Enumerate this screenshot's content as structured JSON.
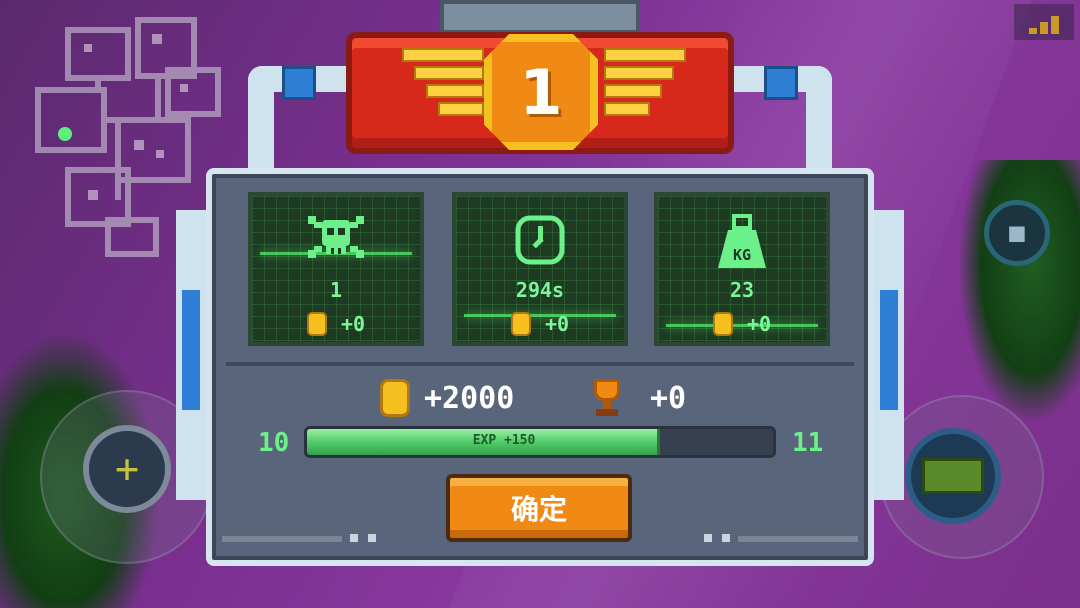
{
  "banner": {
    "rank": "1"
  },
  "stats": [
    {
      "name": "kills",
      "icon": "skull-icon",
      "value": "1",
      "reward": "+0"
    },
    {
      "name": "time",
      "icon": "clock-icon",
      "value": "294s",
      "reward": "+0"
    },
    {
      "name": "weight",
      "icon": "weight-icon",
      "icon_label": "KG",
      "value": "23",
      "reward": "+0"
    }
  ],
  "totals": {
    "coins": "+2000",
    "trophies": "+0"
  },
  "experience": {
    "level_current": "10",
    "level_next": "11",
    "label": "EXP +150",
    "progress": 0.75
  },
  "confirm_label": "确定",
  "colors": {
    "banner_red": "#d8281c",
    "medal_orange": "#f08a14",
    "gold": "#f6c020",
    "terminal_green": "#7ef59a",
    "panel_gray": "#59657a",
    "exp_green": "#4cc864"
  }
}
